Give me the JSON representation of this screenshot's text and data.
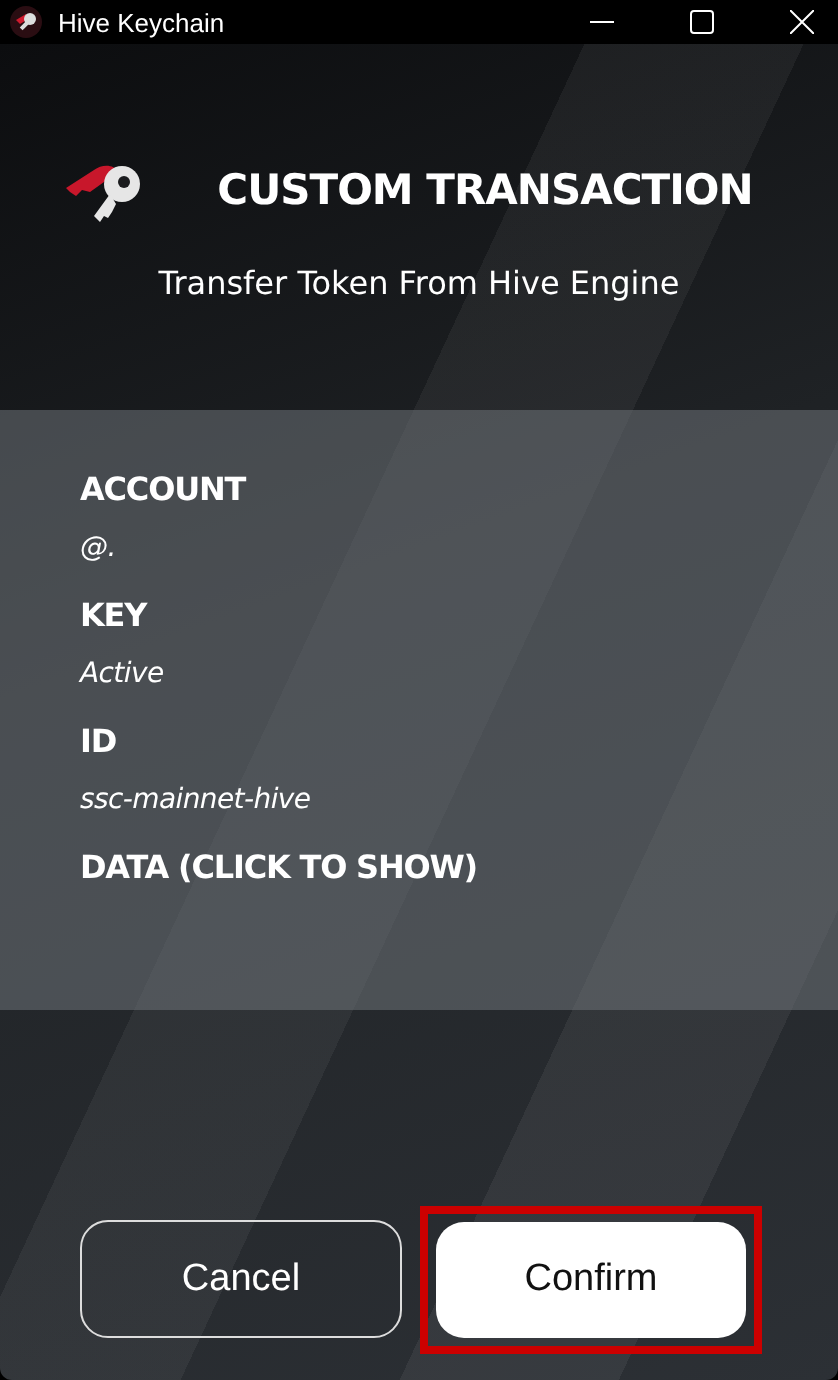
{
  "window": {
    "title": "Hive Keychain"
  },
  "header": {
    "title": "CUSTOM TRANSACTION",
    "subtitle": "Transfer Token From Hive Engine"
  },
  "details": [
    {
      "kind": "field",
      "label": "ACCOUNT",
      "value": "@."
    },
    {
      "kind": "field",
      "label": "KEY",
      "value": "Active"
    },
    {
      "kind": "field",
      "label": "ID",
      "value": "ssc-mainnet-hive"
    },
    {
      "kind": "toggle",
      "label": "DATA (CLICK TO SHOW)"
    }
  ],
  "buttons": [
    {
      "label": "Cancel",
      "kind": "outline",
      "highlighted": false
    },
    {
      "label": "Confirm",
      "kind": "solid",
      "highlighted": true
    }
  ]
}
